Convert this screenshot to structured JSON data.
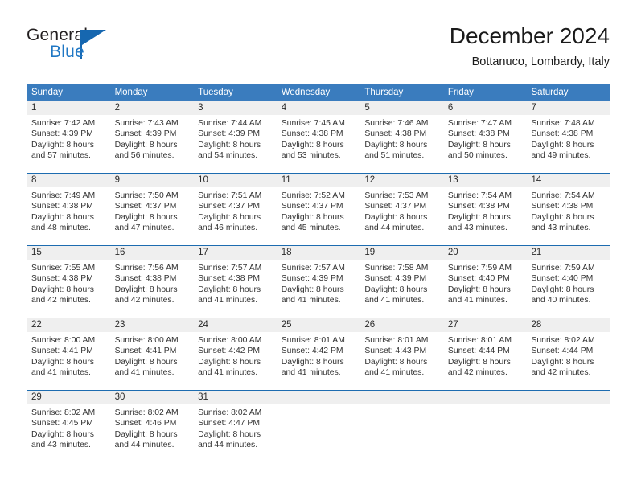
{
  "brand": {
    "name_top": "General",
    "name_bottom": "Blue",
    "accent_color": "#1667b0"
  },
  "header": {
    "title": "December 2024",
    "subtitle": "Bottanuco, Lombardy, Italy"
  },
  "theme": {
    "header_row_bg": "#3a7cbe",
    "date_band_bg": "#efefef",
    "rule_color": "#1d6cb0",
    "text_color": "#333333"
  },
  "weekdays": [
    "Sunday",
    "Monday",
    "Tuesday",
    "Wednesday",
    "Thursday",
    "Friday",
    "Saturday"
  ],
  "weeks": [
    {
      "days": [
        {
          "num": "1",
          "sunrise": "Sunrise: 7:42 AM",
          "sunset": "Sunset: 4:39 PM",
          "daylight1": "Daylight: 8 hours",
          "daylight2": "and 57 minutes."
        },
        {
          "num": "2",
          "sunrise": "Sunrise: 7:43 AM",
          "sunset": "Sunset: 4:39 PM",
          "daylight1": "Daylight: 8 hours",
          "daylight2": "and 56 minutes."
        },
        {
          "num": "3",
          "sunrise": "Sunrise: 7:44 AM",
          "sunset": "Sunset: 4:39 PM",
          "daylight1": "Daylight: 8 hours",
          "daylight2": "and 54 minutes."
        },
        {
          "num": "4",
          "sunrise": "Sunrise: 7:45 AM",
          "sunset": "Sunset: 4:38 PM",
          "daylight1": "Daylight: 8 hours",
          "daylight2": "and 53 minutes."
        },
        {
          "num": "5",
          "sunrise": "Sunrise: 7:46 AM",
          "sunset": "Sunset: 4:38 PM",
          "daylight1": "Daylight: 8 hours",
          "daylight2": "and 51 minutes."
        },
        {
          "num": "6",
          "sunrise": "Sunrise: 7:47 AM",
          "sunset": "Sunset: 4:38 PM",
          "daylight1": "Daylight: 8 hours",
          "daylight2": "and 50 minutes."
        },
        {
          "num": "7",
          "sunrise": "Sunrise: 7:48 AM",
          "sunset": "Sunset: 4:38 PM",
          "daylight1": "Daylight: 8 hours",
          "daylight2": "and 49 minutes."
        }
      ]
    },
    {
      "days": [
        {
          "num": "8",
          "sunrise": "Sunrise: 7:49 AM",
          "sunset": "Sunset: 4:38 PM",
          "daylight1": "Daylight: 8 hours",
          "daylight2": "and 48 minutes."
        },
        {
          "num": "9",
          "sunrise": "Sunrise: 7:50 AM",
          "sunset": "Sunset: 4:37 PM",
          "daylight1": "Daylight: 8 hours",
          "daylight2": "and 47 minutes."
        },
        {
          "num": "10",
          "sunrise": "Sunrise: 7:51 AM",
          "sunset": "Sunset: 4:37 PM",
          "daylight1": "Daylight: 8 hours",
          "daylight2": "and 46 minutes."
        },
        {
          "num": "11",
          "sunrise": "Sunrise: 7:52 AM",
          "sunset": "Sunset: 4:37 PM",
          "daylight1": "Daylight: 8 hours",
          "daylight2": "and 45 minutes."
        },
        {
          "num": "12",
          "sunrise": "Sunrise: 7:53 AM",
          "sunset": "Sunset: 4:37 PM",
          "daylight1": "Daylight: 8 hours",
          "daylight2": "and 44 minutes."
        },
        {
          "num": "13",
          "sunrise": "Sunrise: 7:54 AM",
          "sunset": "Sunset: 4:38 PM",
          "daylight1": "Daylight: 8 hours",
          "daylight2": "and 43 minutes."
        },
        {
          "num": "14",
          "sunrise": "Sunrise: 7:54 AM",
          "sunset": "Sunset: 4:38 PM",
          "daylight1": "Daylight: 8 hours",
          "daylight2": "and 43 minutes."
        }
      ]
    },
    {
      "days": [
        {
          "num": "15",
          "sunrise": "Sunrise: 7:55 AM",
          "sunset": "Sunset: 4:38 PM",
          "daylight1": "Daylight: 8 hours",
          "daylight2": "and 42 minutes."
        },
        {
          "num": "16",
          "sunrise": "Sunrise: 7:56 AM",
          "sunset": "Sunset: 4:38 PM",
          "daylight1": "Daylight: 8 hours",
          "daylight2": "and 42 minutes."
        },
        {
          "num": "17",
          "sunrise": "Sunrise: 7:57 AM",
          "sunset": "Sunset: 4:38 PM",
          "daylight1": "Daylight: 8 hours",
          "daylight2": "and 41 minutes."
        },
        {
          "num": "18",
          "sunrise": "Sunrise: 7:57 AM",
          "sunset": "Sunset: 4:39 PM",
          "daylight1": "Daylight: 8 hours",
          "daylight2": "and 41 minutes."
        },
        {
          "num": "19",
          "sunrise": "Sunrise: 7:58 AM",
          "sunset": "Sunset: 4:39 PM",
          "daylight1": "Daylight: 8 hours",
          "daylight2": "and 41 minutes."
        },
        {
          "num": "20",
          "sunrise": "Sunrise: 7:59 AM",
          "sunset": "Sunset: 4:40 PM",
          "daylight1": "Daylight: 8 hours",
          "daylight2": "and 41 minutes."
        },
        {
          "num": "21",
          "sunrise": "Sunrise: 7:59 AM",
          "sunset": "Sunset: 4:40 PM",
          "daylight1": "Daylight: 8 hours",
          "daylight2": "and 40 minutes."
        }
      ]
    },
    {
      "days": [
        {
          "num": "22",
          "sunrise": "Sunrise: 8:00 AM",
          "sunset": "Sunset: 4:41 PM",
          "daylight1": "Daylight: 8 hours",
          "daylight2": "and 41 minutes."
        },
        {
          "num": "23",
          "sunrise": "Sunrise: 8:00 AM",
          "sunset": "Sunset: 4:41 PM",
          "daylight1": "Daylight: 8 hours",
          "daylight2": "and 41 minutes."
        },
        {
          "num": "24",
          "sunrise": "Sunrise: 8:00 AM",
          "sunset": "Sunset: 4:42 PM",
          "daylight1": "Daylight: 8 hours",
          "daylight2": "and 41 minutes."
        },
        {
          "num": "25",
          "sunrise": "Sunrise: 8:01 AM",
          "sunset": "Sunset: 4:42 PM",
          "daylight1": "Daylight: 8 hours",
          "daylight2": "and 41 minutes."
        },
        {
          "num": "26",
          "sunrise": "Sunrise: 8:01 AM",
          "sunset": "Sunset: 4:43 PM",
          "daylight1": "Daylight: 8 hours",
          "daylight2": "and 41 minutes."
        },
        {
          "num": "27",
          "sunrise": "Sunrise: 8:01 AM",
          "sunset": "Sunset: 4:44 PM",
          "daylight1": "Daylight: 8 hours",
          "daylight2": "and 42 minutes."
        },
        {
          "num": "28",
          "sunrise": "Sunrise: 8:02 AM",
          "sunset": "Sunset: 4:44 PM",
          "daylight1": "Daylight: 8 hours",
          "daylight2": "and 42 minutes."
        }
      ]
    },
    {
      "days": [
        {
          "num": "29",
          "sunrise": "Sunrise: 8:02 AM",
          "sunset": "Sunset: 4:45 PM",
          "daylight1": "Daylight: 8 hours",
          "daylight2": "and 43 minutes."
        },
        {
          "num": "30",
          "sunrise": "Sunrise: 8:02 AM",
          "sunset": "Sunset: 4:46 PM",
          "daylight1": "Daylight: 8 hours",
          "daylight2": "and 44 minutes."
        },
        {
          "num": "31",
          "sunrise": "Sunrise: 8:02 AM",
          "sunset": "Sunset: 4:47 PM",
          "daylight1": "Daylight: 8 hours",
          "daylight2": "and 44 minutes."
        },
        {
          "num": "",
          "sunrise": "",
          "sunset": "",
          "daylight1": "",
          "daylight2": ""
        },
        {
          "num": "",
          "sunrise": "",
          "sunset": "",
          "daylight1": "",
          "daylight2": ""
        },
        {
          "num": "",
          "sunrise": "",
          "sunset": "",
          "daylight1": "",
          "daylight2": ""
        },
        {
          "num": "",
          "sunrise": "",
          "sunset": "",
          "daylight1": "",
          "daylight2": ""
        }
      ]
    }
  ]
}
